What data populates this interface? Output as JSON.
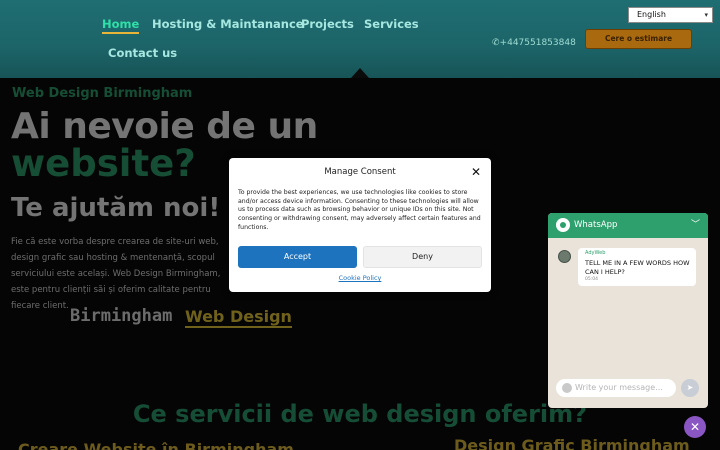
{
  "nav": {
    "home": "Home",
    "hosting": "Hosting & Maintanance",
    "projects": "Projects",
    "services": "Services",
    "contact": "Contact us"
  },
  "header": {
    "phone": "+447551853848",
    "cta": "Cere o estimare",
    "language": "English"
  },
  "hero": {
    "subtitle": "Web Design Birmingham",
    "headline_1": "Ai nevoie de un",
    "headline_2": "website?",
    "headline_3": "Te ajutăm noi!",
    "paragraph": "Fie că este vorba despre crearea de site-uri web, design grafic sau hosting & mentenanță, scopul serviciului este același. Web Design Birmingham, este pentru clienții săi și oferim  calitate  pentru fiecare client.",
    "brand_a": "Birmingham",
    "brand_b": "Web Design"
  },
  "section": {
    "title": "Ce servicii de web design oferim?",
    "left_heading": "Creare Website în Birmingham",
    "right_heading": "Design Grafic Birmingham"
  },
  "consent": {
    "title": "Manage Consent",
    "body": "To provide the best experiences, we use technologies like cookies to store and/or access device information. Consenting to these technologies will allow us to process data such as browsing behavior or unique IDs on this site. Not consenting or withdrawing consent, may adversely affect certain features and functions.",
    "accept": "Accept",
    "deny": "Deny",
    "policy": "Cookie Policy"
  },
  "whatsapp": {
    "title": "WhatsApp",
    "sender": "AdyWeb",
    "message": "TELL ME IN A FEW WORDS HOW CAN I HELP?",
    "time": "05:04",
    "placeholder": "Write your message..."
  },
  "colors": {
    "header": "#1f6e72",
    "accent_green": "#2c9a6a",
    "accent_gold": "#e1c237",
    "accept_blue": "#1e73be",
    "whatsapp_green": "#2ea06d"
  }
}
